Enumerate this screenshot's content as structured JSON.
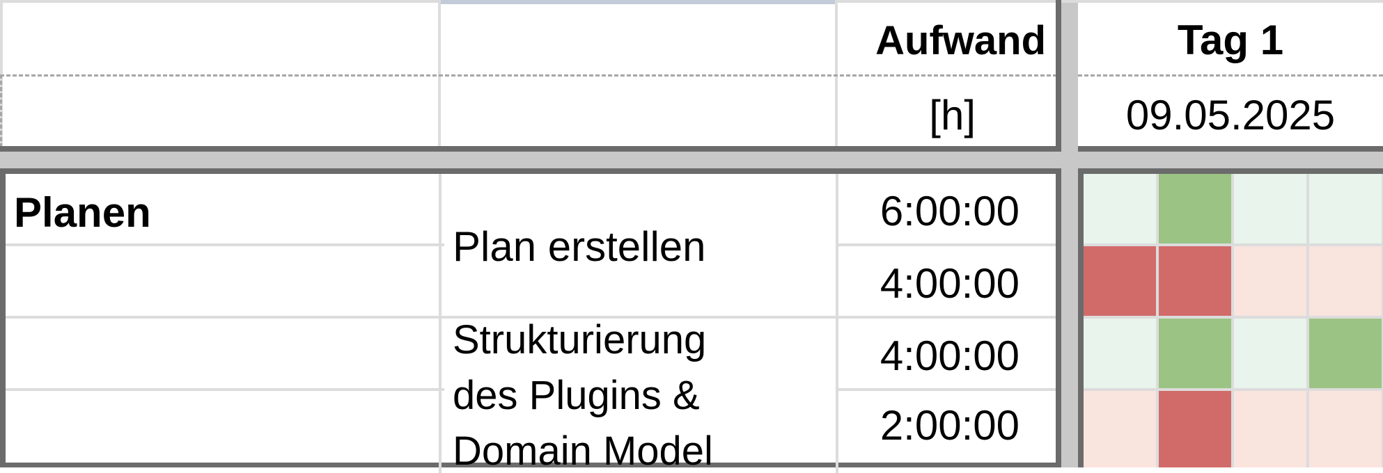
{
  "header": {
    "aufwand_label": "Aufwand",
    "unit_label": "[h]",
    "day_label": "Tag 1",
    "date": "09.05.2025"
  },
  "rows": [
    {
      "phase": "Planen",
      "effort": "6:00:00"
    },
    {
      "phase": "",
      "effort": "4:00:00"
    },
    {
      "phase": "",
      "effort": "4:00:00"
    },
    {
      "phase": "",
      "effort": "2:00:00"
    }
  ],
  "tasks": [
    {
      "lines": [
        "Plan erstellen"
      ]
    },
    {
      "lines": [
        "Strukturierung",
        "des Plugins &",
        "Domain Model"
      ]
    }
  ],
  "colors": {
    "green_dark": "#9bc384",
    "green_light": "#e8f4ec",
    "red_dark": "#d16b6a",
    "red_light": "#fae4de",
    "border_dark": "#6b6b6b",
    "separator_gray": "#c8c8c8",
    "grid_light": "#dcdcdc"
  },
  "day_grid": [
    [
      "green_light",
      "green_dark",
      "green_light",
      "green_light"
    ],
    [
      "red_dark",
      "red_dark",
      "red_light",
      "red_light"
    ],
    [
      "green_light",
      "green_dark",
      "green_light",
      "green_dark"
    ],
    [
      "red_light",
      "red_dark",
      "red_light",
      "red_light"
    ]
  ]
}
